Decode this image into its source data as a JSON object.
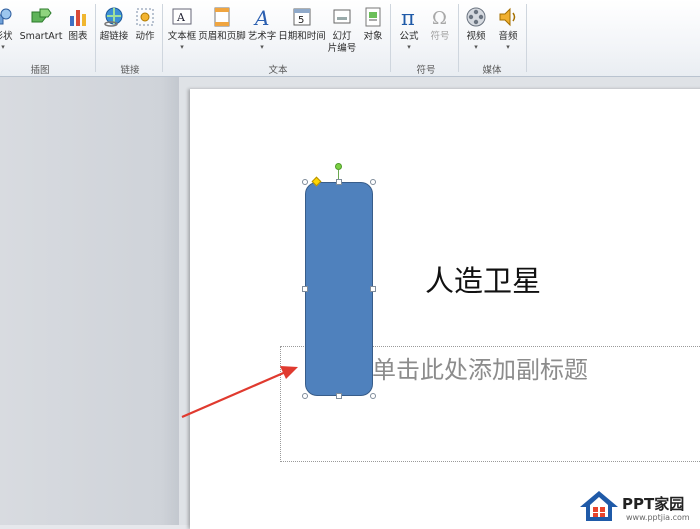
{
  "ribbon": {
    "buttons": {
      "shapes": "形状",
      "smartart": "SmartArt",
      "chart": "图表",
      "hyperlink": "超链接",
      "action": "动作",
      "textbox": "文本框",
      "header_footer": "页眉和页脚",
      "wordart": "艺术字",
      "datetime": "日期和时间",
      "slide_number_l1": "幻灯",
      "slide_number_l2": "片编号",
      "object": "对象",
      "equation": "公式",
      "symbol": "符号",
      "video": "视频",
      "audio": "音频"
    },
    "groups": {
      "illustrations": "插图",
      "links": "链接",
      "text": "文本",
      "symbols": "符号",
      "media": "媒体"
    },
    "dropdown_glyph": "▾"
  },
  "slide": {
    "title": "人造卫星",
    "subtitle_placeholder": "单击此处添加副标题"
  },
  "watermark": {
    "name": "PPT家园",
    "url": "www.pptjia.com"
  },
  "colors": {
    "shape_fill": "#4f81bd",
    "arrow": "#e03a2f"
  }
}
